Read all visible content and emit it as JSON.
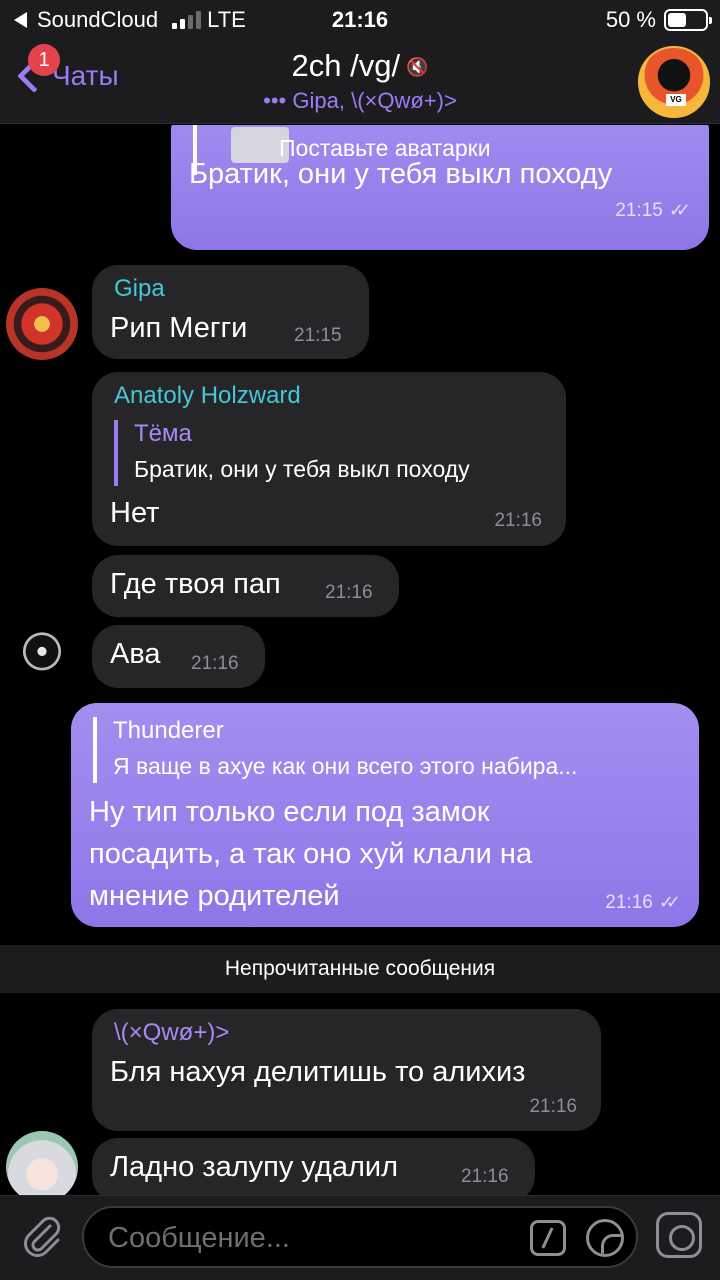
{
  "status_bar": {
    "back_app": "SoundCloud",
    "network": "LTE",
    "time": "21:16",
    "battery": "50 %",
    "battery_level": 0.5
  },
  "nav": {
    "back_label": "Чаты",
    "back_badge": "1",
    "title": "2ch /vg/",
    "typing_indicator": "•••",
    "subtitle": "Gipa, \\(×Qwø+)>",
    "accent_color": "#9b7cf5"
  },
  "messages": {
    "m1": {
      "reply_text": "Поставьте аватарки",
      "text": "Братик, они у тебя выкл походу",
      "time": "21:15",
      "ticks": "✓✓"
    },
    "m2": {
      "sender": "Gipa",
      "text": "Рип Мегги",
      "time": "21:15"
    },
    "m3": {
      "sender": "Anatoly Holzward",
      "reply_name": "Тёма",
      "reply_text": "Братик, они у тебя выкл походу",
      "text": "Нет",
      "time": "21:16"
    },
    "m4": {
      "text": "Где твоя пап",
      "time": "21:16"
    },
    "m5": {
      "text": "Ава",
      "time": "21:16"
    },
    "m6": {
      "reply_name": "Thunderer",
      "reply_text": "Я ваще в ахуе как они всего этого набира...",
      "text_line1": "Ну тип только если под замок",
      "text_line2": "посадить, а так оно хуй клали на",
      "text_line3": "мнение родителей",
      "time": "21:16",
      "ticks": "✓✓"
    },
    "m7": {
      "sender": "\\(×Qwø+)>",
      "text": "Бля нахуя делитишь то алихиз",
      "time": "21:16"
    },
    "m8": {
      "text": "Ладно залупу удалил",
      "time": "21:16"
    }
  },
  "unread_label": "Непрочитанные сообщения",
  "input": {
    "placeholder": "Сообщение..."
  },
  "colors": {
    "sender_gipa": "#44c8d6",
    "sender_anatoly": "#44c8d6",
    "sender_qwo": "#a98af5",
    "outgoing_bubble": "#9a82ee",
    "incoming_bubble": "#262628"
  }
}
